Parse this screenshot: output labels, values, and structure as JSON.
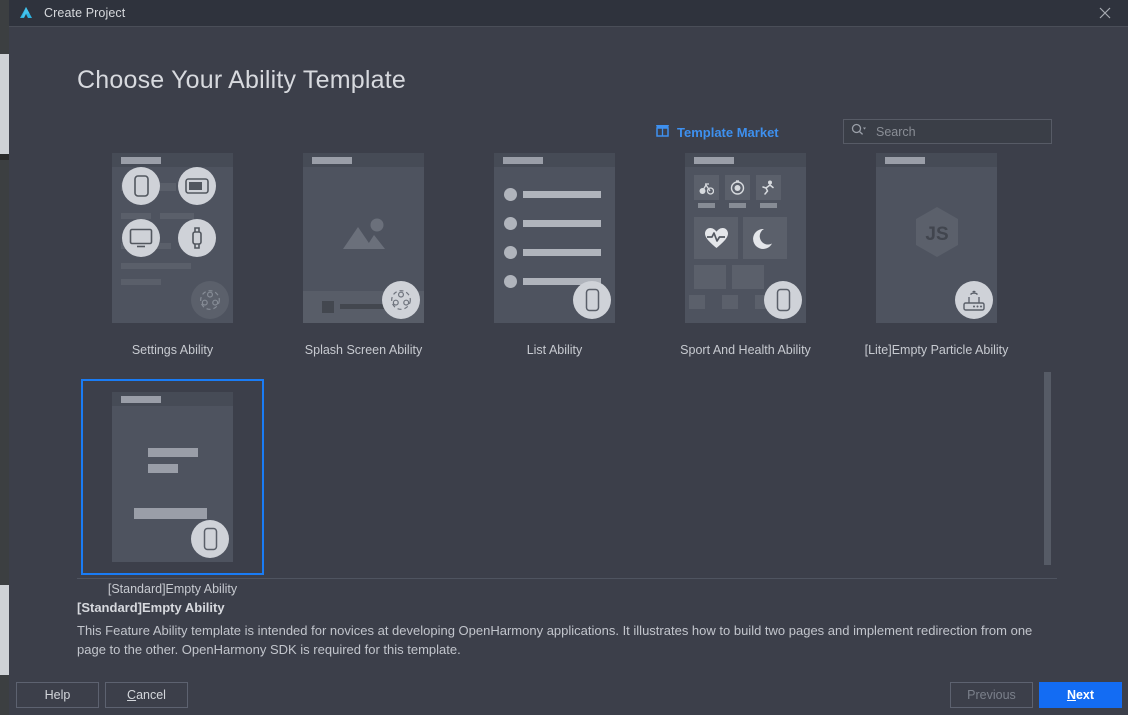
{
  "window": {
    "title": "Create Project",
    "logo_icon": "deveco-studio-logo-icon",
    "close_icon": "close-icon"
  },
  "page_title": "Choose Your Ability Template",
  "template_market": {
    "label": "Template Market",
    "icon": "template-market-store-icon",
    "color": "#3e90ef"
  },
  "search": {
    "placeholder": "Search",
    "value": "",
    "icon": "search-icon",
    "dropdown_icon": "chevron-down-icon"
  },
  "templates": [
    {
      "label": "Settings Ability",
      "selected": false,
      "badge_icon": "multi-device-icon"
    },
    {
      "label": "Splash Screen Ability",
      "selected": false,
      "badge_icon": "multi-device-icon"
    },
    {
      "label": "List Ability",
      "selected": false,
      "badge_icon": "phone-icon"
    },
    {
      "label": "Sport And Health Ability",
      "selected": false,
      "badge_icon": "phone-icon"
    },
    {
      "label": "[Lite]Empty Particle Ability",
      "selected": false,
      "badge_icon": "router-icon"
    },
    {
      "label": "[Standard]Empty Ability",
      "selected": true,
      "badge_icon": "phone-icon"
    }
  ],
  "selection": {
    "accent_color": "#1a7cf5",
    "title": "[Standard]Empty Ability",
    "description": "This Feature Ability template is intended for novices at developing OpenHarmony applications. It illustrates how to build two pages and implement redirection from one page to the other. OpenHarmony SDK is required for this template."
  },
  "footer": {
    "help": "Help",
    "cancel": "Cancel",
    "cancel_mnemonic": "C",
    "previous": "Previous",
    "next": "Next",
    "next_mnemonic": "N",
    "next_color": "#136cf3"
  }
}
